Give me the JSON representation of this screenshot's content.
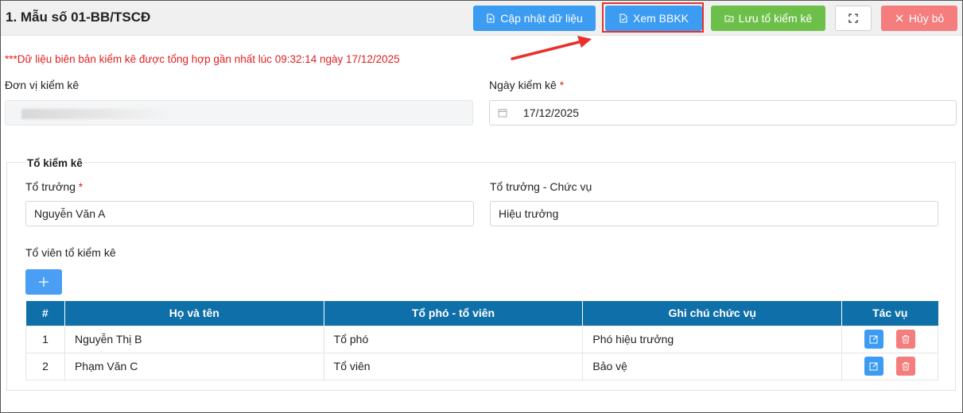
{
  "header": {
    "title": "1. Mẫu số 01-BB/TSCĐ",
    "buttons": {
      "update_label": "Cập nhật dữ liệu",
      "view_label": "Xem BBKK",
      "save_label": "Lưu tổ kiểm kê",
      "cancel_label": "Hủy bỏ"
    }
  },
  "notice": "***Dữ liệu biên bản kiểm kê được tổng hợp gần nhất lúc 09:32:14 ngày 17/12/2025",
  "form": {
    "unit_label": "Đơn vị kiểm kê",
    "date_label": "Ngày kiểm kê",
    "date_value": "17/12/2025",
    "required_mark": "*"
  },
  "team": {
    "legend": "Tổ kiểm kê",
    "leader_label": "Tổ trưởng",
    "leader_value": "Nguyễn Văn A",
    "leader_position_label": "Tổ trưởng - Chức vụ",
    "leader_position_value": "Hiệu trưởng",
    "members_label": "Tổ viên tổ kiểm kê",
    "add_icon": "plus-icon"
  },
  "table": {
    "headers": [
      "#",
      "Họ và tên",
      "Tổ phó - tổ viên",
      "Ghi chú chức vụ",
      "Tác vụ"
    ],
    "rows": [
      {
        "no": "1",
        "name": "Nguyễn Thị B",
        "role": "Tổ phó",
        "note": "Phó hiệu trưởng"
      },
      {
        "no": "2",
        "name": "Phạm Văn C",
        "role": "Tổ viên",
        "note": "Bảo vệ"
      }
    ]
  },
  "colors": {
    "primary": "#3c9cf2",
    "success": "#6cc04a",
    "danger": "#f47d7d",
    "table_header": "#0f6fa8",
    "highlight": "#e8312b"
  }
}
